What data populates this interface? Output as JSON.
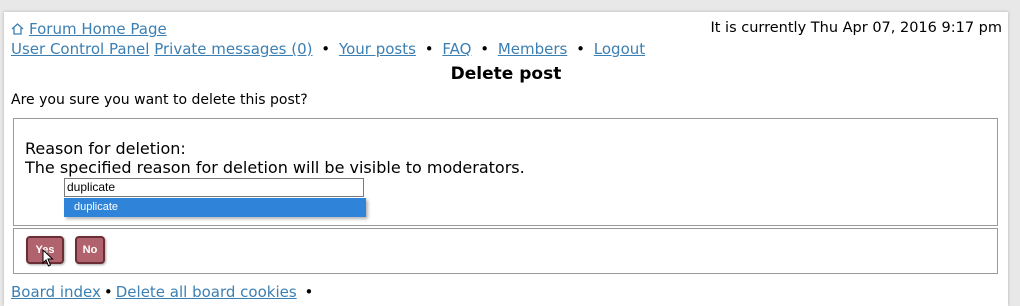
{
  "header": {
    "home_link": "Forum Home Page",
    "clock_text": "It is currently Thu Apr 07, 2016 9:17 pm"
  },
  "nav": {
    "items": [
      "User Control Panel",
      "Private messages (0)",
      "Your posts",
      "FAQ",
      "Members",
      "Logout"
    ],
    "separator": "•"
  },
  "main": {
    "title": "Delete post",
    "question": "Are you sure you want to delete this post?",
    "reason_label": "Reason for deletion:",
    "reason_help": "The specified reason for deletion will be visible to moderators.",
    "reason_value": "duplicate",
    "autocomplete_option": "duplicate"
  },
  "actions": {
    "yes_label": "Yes",
    "no_label": "No"
  },
  "footer": {
    "board_index": "Board index",
    "delete_cookies": "Delete all board cookies",
    "separator": "•"
  },
  "colors": {
    "link": "#3b7fb3",
    "button": "#b0636c",
    "autocomplete_highlight": "#2f83d8"
  },
  "icons": {
    "home": "home-icon",
    "cursor": "mouse-pointer-icon"
  }
}
